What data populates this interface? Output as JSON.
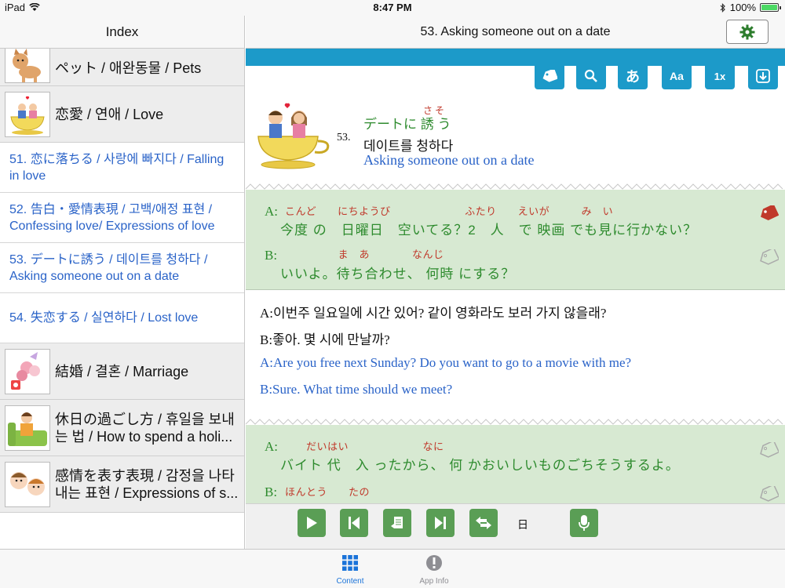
{
  "status": {
    "device": "iPad",
    "time": "8:47 PM",
    "battery": "100%",
    "battery_level": 1.0
  },
  "sidebar": {
    "title": "Index",
    "categories_top": [
      {
        "label": "ペット / 애완동물 / Pets"
      },
      {
        "label": "恋愛 / 연애 / Love"
      }
    ],
    "lessons": [
      {
        "label": "51. 恋に落ちる / 사랑에 빠지다 / Falling in love"
      },
      {
        "label": "52. 告白・愛情表現 / 고백/애정 표현 / Confessing love/ Expressions of love"
      },
      {
        "label": "53. デートに誘う / 데이트를 청하다 / Asking someone out on a date"
      },
      {
        "label": "54. 失恋する / 실연하다 / Lost love"
      }
    ],
    "categories_bottom": [
      {
        "label": "結婚 / 결혼 / Marriage"
      },
      {
        "label": "休日の過ごし方 / 휴일을 보내는 법 / How to spend a holi..."
      },
      {
        "label": "感情を表す表現 / 감정을 나타내는 표현 / Expressions of s..."
      }
    ]
  },
  "header": {
    "title": "53. Asking someone out on a date"
  },
  "toolbar": {
    "kana_label": "あ",
    "font_label": "Aa",
    "speed_label": "1x"
  },
  "lesson": {
    "number": "53.",
    "title_jp": "デートに 誘 う",
    "title_jp_ruby": "さそ",
    "title_ko": "데이트를 청하다",
    "title_en": "Asking someone out on a date"
  },
  "dialog1": {
    "a_label": "A:",
    "a_ruby": "こんど　　にちようび　　　　　　　ふたり　　えいが　　　み　い",
    "a_text": "今度 の　日曜日　空いてる？2　人　で 映画 でも見に行かない？",
    "b_label": "B:",
    "b_ruby": "　　　　　ま　あ　　　　なんじ",
    "b_text": "いいよ。待ち合わせ、 何時 にする？"
  },
  "translation": {
    "ko_a": "A:이번주 일요일에 시간 있어? 같이 영화라도 보러 가지 않을래?",
    "ko_b": "B:좋아. 몇 시에 만날까?",
    "en_a": "A:Are you free next Sunday? Do you want to go to a movie with me?",
    "en_b": "B:Sure. What time should we meet?"
  },
  "dialog2": {
    "a_label": "A:",
    "a_ruby": "　　だいはい　　　　　　　なに",
    "a_text": "バイト 代　入 ったから、 何 かおいしいものごちそうするよ。",
    "b_label": "B:",
    "b_ruby": "ほんとう　　たの"
  },
  "player": {
    "day": "日"
  },
  "tabs": [
    {
      "label": "Content"
    },
    {
      "label": "App Info"
    }
  ],
  "colors": {
    "accent_blue": "#1c9ac9",
    "green_text": "#2e8b2e",
    "ruby_red": "#c0392b",
    "link_blue": "#2a63c8",
    "dialog_bg": "#d7e9d2",
    "player_green": "#5a9e55",
    "tab_active": "#1a73d9"
  }
}
